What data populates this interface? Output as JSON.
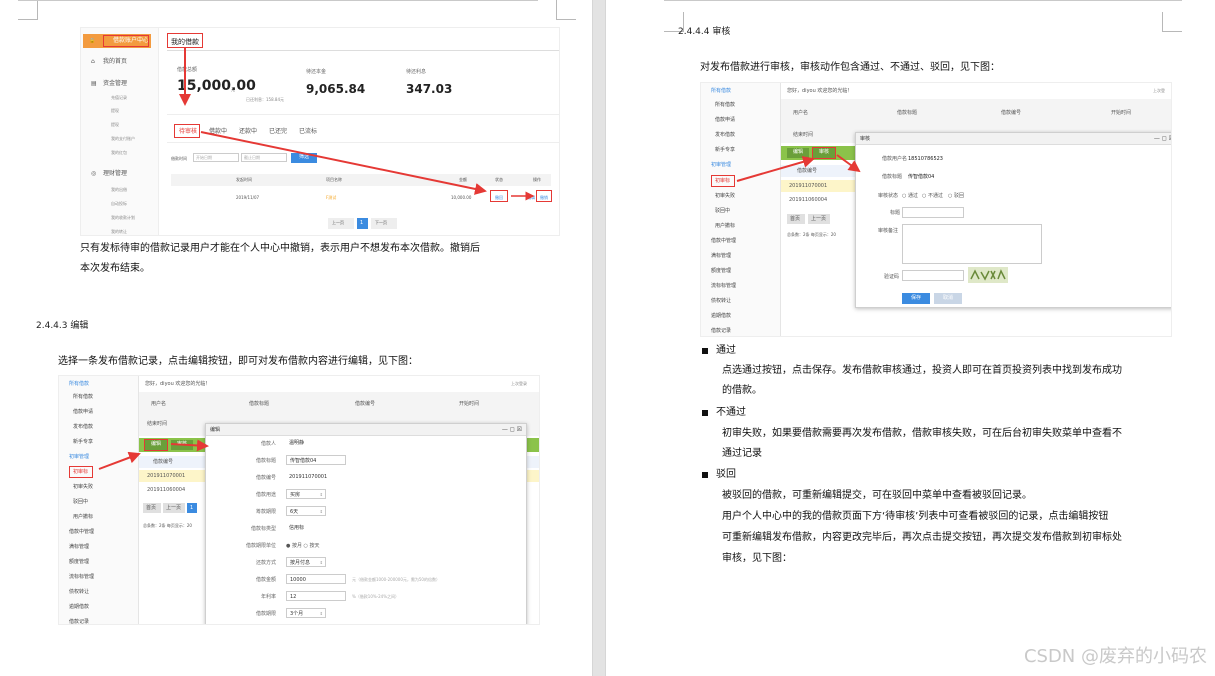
{
  "left_page": {
    "fig1": {
      "sidebar_title": "借款账户中心",
      "tab_title": "我的借款",
      "menu_home": "我的首页",
      "menu_funds": "资金管理",
      "menu_funds_items": [
        "充值记录",
        "提现",
        "提现",
        "我的支付账户",
        "我的红包"
      ],
      "menu_finance": "理财管理",
      "menu_finance_items": [
        "我的出借",
        "自动投标",
        "我的收款计划",
        "我的转让"
      ],
      "label_total": "借款总额",
      "total_amount": "15,000.00",
      "unit": "元",
      "label_paid": "待还本金",
      "paid_amount": "9,065.84",
      "label_count": "待还利息",
      "count_value": "347.03",
      "repaid_label": "已还利息：158.84元",
      "tabs": [
        "待审核",
        "借款中",
        "还款中",
        "已还完",
        "已流标"
      ],
      "filter_label": "借款时间",
      "filter_start": "开始日期",
      "filter_end": "截止日期",
      "filter_button": "筛选",
      "cols": [
        "发起时间",
        "项目名称",
        "金额",
        "状态",
        "操作"
      ],
      "row": [
        "2019/11/07",
        "F测试",
        "10,000.00",
        "撤回",
        "编辑",
        "撤销"
      ],
      "pager_prev": "上一页",
      "pager_page": "1",
      "pager_next": "下一页"
    },
    "para1": "只有发标待审的借款记录用户才能在个人中心中撤销，表示用户不想发布本次借款。撤销后",
    "para1b": "本次发布结束。",
    "h_edit": "2.4.4.3  编辑",
    "para2": "选择一条发布借款记录，点击编辑按钮，即可对发布借款内容进行编辑，见下图：",
    "fig2": {
      "greeting": "您好，diyou 欢迎您的光临！",
      "top_right": "上次登录",
      "side": [
        "所有借款",
        "所有借款",
        "借款申请",
        "发布借款",
        "新手专享",
        "初审管理",
        "初审标",
        "初审失败",
        "驳回中",
        "用户撤标",
        "借款中管理",
        "满标管理",
        "额度管理",
        "流标标管理",
        "债权转让",
        "逾期借款",
        "借款记录"
      ],
      "filter_labels": [
        "用户名",
        "借款标题",
        "借款编号",
        "开始时间",
        "结束时间"
      ],
      "btn_edit": "编辑",
      "btn_audit": "审核",
      "table_head": "借款编号",
      "rows": [
        "201911070001",
        "201911060004"
      ],
      "pager": [
        "首页",
        "上一页",
        "1"
      ],
      "summary": "总条数：2条 每页显示：20",
      "dlg_title": "编辑",
      "dlg_fields": [
        {
          "label": "借款人",
          "value": "温明静"
        },
        {
          "label": "借款标题",
          "value": "传智借款04"
        },
        {
          "label": "借款编号",
          "value": "201911070001"
        },
        {
          "label": "借款用途",
          "value": "买房"
        },
        {
          "label": "筹款期限",
          "value": "6天"
        },
        {
          "label": "借款标类型",
          "value": "信用标"
        },
        {
          "label": "借款期限单位",
          "value": "按月"
        },
        {
          "label": "还款方式",
          "value": "按月付息"
        },
        {
          "label": "借款金额",
          "value": "10000"
        },
        {
          "label": "年利率",
          "value": "12"
        },
        {
          "label": "借款期限",
          "value": "3个月"
        }
      ],
      "dlg_radio_alt": "按天",
      "dlg_hint_amount": "元（借款金额1000-200000元，需为50的倍数）",
      "dlg_hint_rate": "%（借款10%-24%之间）"
    }
  },
  "right_page": {
    "h_audit": "2.4.4.4  审核",
    "intro": "对发布借款进行审核，审核动作包含通过、不通过、驳回，见下图：",
    "fig3": {
      "greeting": "您好，diyou 欢迎您的光临！",
      "top_right": "上次登",
      "filter_labels": [
        "用户名",
        "借款标题",
        "借款编号",
        "开始时间",
        "结束时间"
      ],
      "btn_edit": "编辑",
      "btn_audit": "审核",
      "table_head": "借款编号",
      "rows": [
        "201911070001",
        "201911060004"
      ],
      "pager": [
        "首页",
        "上一页"
      ],
      "summary": "总条数：2条 每页显示：20",
      "side": [
        "所有借款",
        "所有借款",
        "借款申请",
        "发布借款",
        "新手专享",
        "初审管理",
        "初审标",
        "初审失败",
        "驳回中",
        "用户撤标",
        "借款中管理",
        "满标管理",
        "额度管理",
        "流标标管理",
        "债权转让",
        "逾期借款",
        "借款记录"
      ],
      "dlg_title": "审核",
      "dlg_user_label": "借款用户名",
      "dlg_user": "18510786523",
      "dlg_title_label": "借款标题",
      "dlg_title_value": "传智借款04",
      "dlg_state_label": "审核状态",
      "dlg_states": [
        "通过",
        "不通过",
        "驳回"
      ],
      "dlg_tag_label": "标题",
      "dlg_remark_label": "审核备注",
      "dlg_code_label": "验证码",
      "dlg_save": "保存",
      "dlg_cancel": "取消"
    },
    "b1_title": "通过",
    "b1_text": "点选通过按钮，点击保存。发布借款审核通过，投资人即可在首页投资列表中找到发布成功",
    "b1_text2": "的借款。",
    "b2_title": "不通过",
    "b2_text": "初审失败，如果要借款需要再次发布借款，借款审核失败，可在后台初审失败菜单中查看不",
    "b2_text2": "通过记录",
    "b3_title": "驳回",
    "b3_text": "被驳回的借款，可重新编辑提交，可在驳回中菜单中查看被驳回记录。",
    "b3_text2": "用户个人中心中的我的借款页面下方‘待审核’列表中可查看被驳回的记录，点击编辑按钮",
    "b3_text3": "可重新编辑发布借款，内容更改完毕后，再次点击提交按钮，再次提交发布借款到初审标处",
    "b3_text4": "审核，见下图："
  },
  "watermark": "CSDN @废弃的小码农",
  "colors": {
    "accent_red": "#e53935",
    "orange": "#f5a623",
    "blue": "#3b8be0",
    "green": "#4caf50",
    "highlight": "#fdf5c9"
  }
}
